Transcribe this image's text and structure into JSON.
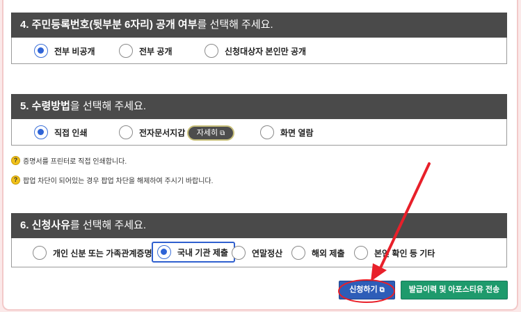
{
  "sections": [
    {
      "title_bold": "4. 주민등록번호(뒷부분 6자리) 공개 여부",
      "title_rest": "를 선택해 주세요.",
      "options": [
        {
          "label": "전부 비공개",
          "selected": true
        },
        {
          "label": "전부 공개",
          "selected": false
        },
        {
          "label": "신청대상자 본인만 공개",
          "selected": false
        }
      ]
    },
    {
      "title_bold": "5. 수령방법",
      "title_rest": "을 선택해 주세요.",
      "options": [
        {
          "label": "직접 인쇄",
          "selected": true
        },
        {
          "label": "전자문서지갑",
          "selected": false
        },
        {
          "label": "화면 열람",
          "selected": false
        }
      ],
      "detail_button": "자세히",
      "notes": [
        "증명서를 프린터로 직접 인쇄합니다.",
        "팝업 차단이 되어있는 경우 팝업 차단을 해제하여 주시기 바랍니다."
      ]
    },
    {
      "title_bold": "6. 신청사유",
      "title_rest": "를 선택해 주세요.",
      "options": [
        {
          "label": "개인 신분 또는 가족관계증명",
          "selected": false
        },
        {
          "label": "국내 기관 제출",
          "selected": true
        },
        {
          "label": "연말정산",
          "selected": false
        },
        {
          "label": "해외 제출",
          "selected": false
        },
        {
          "label": "본인 확인 등 기타",
          "selected": false
        }
      ]
    }
  ],
  "buttons": {
    "apply": "신청하기",
    "history": "발급이력 및 아포스티유 전송"
  },
  "icons": {
    "external_link": "external-link-icon",
    "help": "question-icon"
  },
  "colors": {
    "header_bg": "#4a4a4a",
    "radio_selected": "#2f64d6",
    "apply_btn": "#2e5db8",
    "history_btn": "#1e9a6c",
    "annotation": "#e8202a"
  }
}
